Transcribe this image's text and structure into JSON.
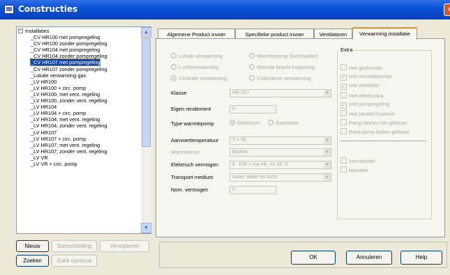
{
  "window": {
    "title": "Constructies",
    "close_glyph": "×",
    "app_icon": "window-app-icon"
  },
  "tree": {
    "root_label": "Installaties",
    "items": [
      "_CV HR100 met pompregeling",
      "_CV HR100 zonder pompregeling",
      "_CV HR104 met pompregeling",
      "_CV HR104 zonder pompregeling",
      "_CV HR107 met pompregeling",
      "_CV HR107 zonder pompregeling",
      "_Lokale verwarming gas",
      "_LV HR100",
      "_LV HR100 + circ. pomp",
      "_LV HR100, met vent. regeling",
      "_LV HR100, zonder vent. regeling",
      "_LV HR104",
      "_LV HR104 + circ. pomp",
      "_LV HR104, met vent. regeling",
      "_LV HR104, zonder vent. regeling",
      "_LV HR107",
      "_LV HR107 + circ. pomp",
      "_LV HR107, met vent. regeling",
      "_LV HR107, zonder vent. regeling",
      "_LV VR",
      "_LV VR + circ. pomp"
    ],
    "selected_index": 4
  },
  "left_buttons": {
    "nieuw": "Nieuw",
    "samenstelling": "Samenstelling",
    "verwijderen": "Verwijderen",
    "zoeken": "Zoeken",
    "zoek_opnieuw": "Zoek opnieuw"
  },
  "tabs": [
    "Algemene Product invoer",
    "Specifieke product invoer",
    "Ventilatoren",
    "Verwarming installatie"
  ],
  "active_tab": 3,
  "heating_type_options": {
    "lokale": "Lokale verwarming",
    "luchtverwarming": "Luchtverwarming",
    "centrale": "Centrale verwarming",
    "warmtepomp": "Warmtepomp (lucht/water)",
    "wkk": "Warmte kracht koppeling",
    "collectieve": "Collectieve verwarming"
  },
  "form": {
    "klasse_label": "Klasse",
    "klasse_value": "HR-107",
    "eigen_rendement_label": "Eigen rendement",
    "eigen_rendement_value": "0",
    "type_warmtepomp_label": "Type warmtepomp",
    "type_elektrisch": "Elektrisch",
    "type_gasmotor": "Gasmotor",
    "aanvoertemperatuur_label": "Aanvoertemperatuur",
    "aanvoertemperatuur_value": "T > 55",
    "warmtebron_label": "Warmtebron",
    "warmtebron_value": "Bodem",
    "elektrisch_vermogen_label": "Elektrisch vermogen",
    "elektrisch_vermogen_value": "6",
    "elektrisch_vermogen_unit": "KW < ma ink. <= 20",
    "elektrisch_vermogen_extra": "0",
    "transport_medium_label": "Transport medium",
    "transport_medium_value": "water, water en lucht",
    "nom_vermogen_label": "Nom. vermogen",
    "nom_vermogen_value": "0"
  },
  "extra": {
    "title": "Extra",
    "options": [
      {
        "label": "met gasfornuis",
        "checked": false
      },
      {
        "label": "met circulatiepomp",
        "checked": true
      },
      {
        "label": "met ventilator",
        "checked": true
      },
      {
        "label": "met elektronica",
        "checked": false
      },
      {
        "label": "met pompregeling",
        "checked": true
      },
      {
        "label": "met parallel buitenvt",
        "checked": false
      },
      {
        "label": "Pomp binnen het gebouw",
        "checked": false
      },
      {
        "label": "Extra pomp buiten gebouw",
        "checked": false
      }
    ],
    "options2": [
      {
        "label": "zonneboiler",
        "checked": false
      },
      {
        "label": "tapwater",
        "checked": false
      }
    ]
  },
  "dialog_buttons": {
    "ok": "OK",
    "annuleren": "Annuleren",
    "help": "Help"
  }
}
